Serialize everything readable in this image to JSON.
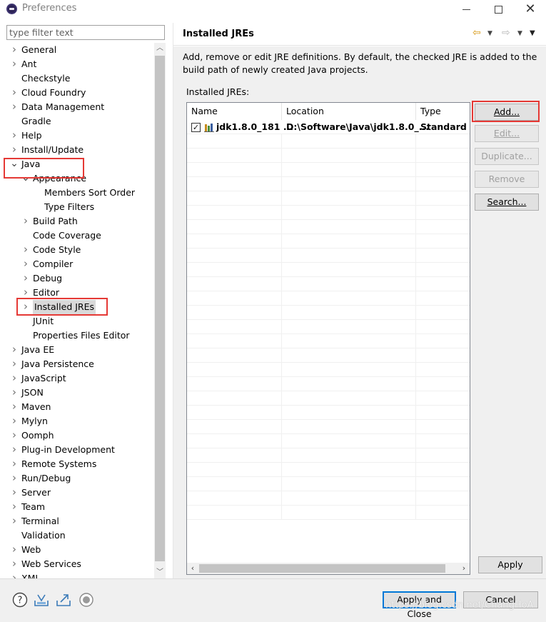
{
  "window": {
    "title": "Preferences",
    "minimize_glyph": "—",
    "maximize_glyph": "☐",
    "close_glyph": "✕"
  },
  "filter": {
    "placeholder": "type filter text"
  },
  "tree": {
    "items": [
      {
        "label": "General",
        "state": "collapsed"
      },
      {
        "label": "Ant",
        "state": "collapsed"
      },
      {
        "label": "Checkstyle",
        "state": "leaf"
      },
      {
        "label": "Cloud Foundry",
        "state": "collapsed"
      },
      {
        "label": "Data Management",
        "state": "collapsed"
      },
      {
        "label": "Gradle",
        "state": "leaf"
      },
      {
        "label": "Help",
        "state": "collapsed"
      },
      {
        "label": "Install/Update",
        "state": "collapsed"
      },
      {
        "label": "Java",
        "state": "expanded"
      },
      {
        "label": "Appearance",
        "state": "expanded"
      },
      {
        "label": "Members Sort Order",
        "state": "leaf"
      },
      {
        "label": "Type Filters",
        "state": "leaf"
      },
      {
        "label": "Build Path",
        "state": "collapsed"
      },
      {
        "label": "Code Coverage",
        "state": "leaf"
      },
      {
        "label": "Code Style",
        "state": "collapsed"
      },
      {
        "label": "Compiler",
        "state": "collapsed"
      },
      {
        "label": "Debug",
        "state": "collapsed"
      },
      {
        "label": "Editor",
        "state": "collapsed"
      },
      {
        "label": "Installed JREs",
        "state": "collapsed",
        "selected": true
      },
      {
        "label": "JUnit",
        "state": "leaf"
      },
      {
        "label": "Properties Files Editor",
        "state": "leaf"
      },
      {
        "label": "Java EE",
        "state": "collapsed"
      },
      {
        "label": "Java Persistence",
        "state": "collapsed"
      },
      {
        "label": "JavaScript",
        "state": "collapsed"
      },
      {
        "label": "JSON",
        "state": "collapsed"
      },
      {
        "label": "Maven",
        "state": "collapsed"
      },
      {
        "label": "Mylyn",
        "state": "collapsed"
      },
      {
        "label": "Oomph",
        "state": "collapsed"
      },
      {
        "label": "Plug-in Development",
        "state": "collapsed"
      },
      {
        "label": "Remote Systems",
        "state": "collapsed"
      },
      {
        "label": "Run/Debug",
        "state": "collapsed"
      },
      {
        "label": "Server",
        "state": "collapsed"
      },
      {
        "label": "Team",
        "state": "collapsed"
      },
      {
        "label": "Terminal",
        "state": "collapsed"
      },
      {
        "label": "Validation",
        "state": "leaf"
      },
      {
        "label": "Web",
        "state": "collapsed"
      },
      {
        "label": "Web Services",
        "state": "collapsed"
      },
      {
        "label": "XML",
        "state": "collapsed"
      }
    ]
  },
  "page": {
    "title": "Installed JREs",
    "description": "Add, remove or edit JRE definitions. By default, the checked JRE is added to the build path of newly created Java projects.",
    "installed_label": "Installed JREs:",
    "columns": [
      "Name",
      "Location",
      "Type"
    ],
    "rows": [
      {
        "checked": true,
        "name": "jdk1.8.0_181 ...",
        "location": "D:\\Software\\Java\\jdk1.8.0_...",
        "type": "Standard V"
      }
    ]
  },
  "buttons": {
    "add": "Add...",
    "edit": "Edit...",
    "duplicate": "Duplicate...",
    "remove": "Remove",
    "search": "Search...",
    "apply": "Apply",
    "apply_close": "Apply and Close",
    "cancel": "Cancel"
  },
  "watermark": "https://blog.csdn.net/ChangHoA",
  "colors": {
    "highlight": "#e53935",
    "default_button_border": "#0078d7",
    "nav_arrow": "#d79a17"
  }
}
